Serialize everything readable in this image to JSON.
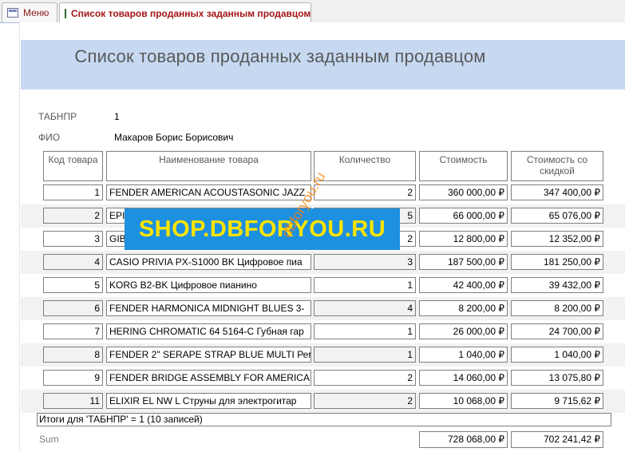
{
  "tabs": {
    "menu": {
      "label": "Меню",
      "icon": "form-icon"
    },
    "report": {
      "label": "Список товаров проданных заданным продавцом",
      "icon": "report-icon"
    }
  },
  "report": {
    "title": "Список товаров проданных заданным продавцом",
    "tabnpr_label": "ТАБНПР",
    "tabnpr_value": "1",
    "fio_label": "ФИО",
    "fio_value": "Макаров Борис Борисович",
    "columns": [
      "Код товара",
      "Наименование товара",
      "Количество",
      "Стоимость",
      "Стоимость со скидкой"
    ],
    "rows": [
      {
        "code": "1",
        "name": "FENDER AMERICAN ACOUSTASONIC JAZZ",
        "qty": "2",
        "cost": "360 000,00 ₽",
        "disc": "347 400,00 ₽"
      },
      {
        "code": "2",
        "name": "EPIPHONE",
        "qty": "5",
        "cost": "66 000,00 ₽",
        "disc": "65 076,00 ₽"
      },
      {
        "code": "3",
        "name": "GIBSON",
        "qty": "2",
        "cost": "12 800,00 ₽",
        "disc": "12 352,00 ₽"
      },
      {
        "code": "4",
        "name": "CASIO PRIVIA PX-S1000 BK Цифровое пиа",
        "qty": "3",
        "cost": "187 500,00 ₽",
        "disc": "181 250,00 ₽"
      },
      {
        "code": "5",
        "name": "KORG B2-BK Цифровое пианино",
        "qty": "1",
        "cost": "42 400,00 ₽",
        "disc": "39 432,00 ₽"
      },
      {
        "code": "6",
        "name": "FENDER HARMONICA MIDNIGHT BLUES 3-",
        "qty": "4",
        "cost": "8 200,00 ₽",
        "disc": "8 200,00 ₽"
      },
      {
        "code": "7",
        "name": "HERING CHROMATIC 64 5164-C Губная гар",
        "qty": "1",
        "cost": "26 000,00 ₽",
        "disc": "24 700,00 ₽"
      },
      {
        "code": "8",
        "name": "FENDER 2\" SERAPE STRAP BLUE MULTI Рем",
        "qty": "1",
        "cost": "1 040,00 ₽",
        "disc": "1 040,00 ₽"
      },
      {
        "code": "9",
        "name": "FENDER BRIDGE ASSEMBLY FOR AMERICAI",
        "qty": "2",
        "cost": "14 060,00 ₽",
        "disc": "13 075,80 ₽"
      },
      {
        "code": "11",
        "name": "ELIXIR EL NW L Струны для электрогитар",
        "qty": "2",
        "cost": "10 068,00 ₽",
        "disc": "9 715,62 ₽"
      }
    ],
    "summary_text": "Итоги для 'ТАБНПР' =  1 (10 записей)",
    "sum_label": "Sum",
    "sum_cost": "728 068,00 ₽",
    "sum_disc": "702 241,42 ₽"
  },
  "watermark": {
    "banner": "SHOP.DBFORYOU.RU",
    "diagonal": "dbforyou.ru"
  },
  "colors": {
    "title_band": "#c6d9f1",
    "shade_row": "#f2f2f2",
    "tab_active_text": "#a31515",
    "watermark_bg": "#1e90e0",
    "watermark_text": "#ffe400"
  }
}
